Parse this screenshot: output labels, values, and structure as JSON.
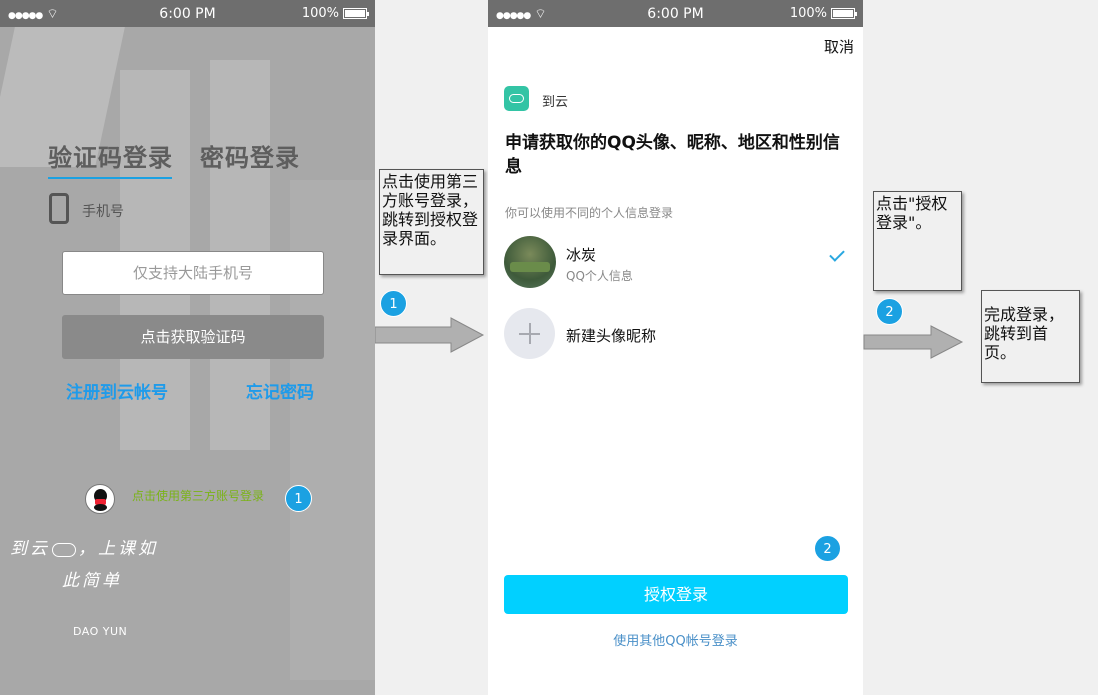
{
  "status": {
    "signal": "●●●●●",
    "time": "6:00 PM",
    "battery": "100%"
  },
  "login": {
    "tab_sms": "验证码登录",
    "tab_password": "密码登录",
    "phone_label": "手机号",
    "phone_placeholder": "仅支持大陆手机号",
    "get_code_button": "点击获取验证码",
    "register_link": "注册到云帐号",
    "forgot_link": "忘记密码",
    "third_party_text": "点击使用第三方账号登录",
    "badge": "1",
    "slogan_line1": "到云",
    "slogan_line1b": "，上课如",
    "slogan_line2": "此简单",
    "brand": "DAO YUN"
  },
  "notes": {
    "note1": "点击使用第三方账号登录，跳转到授权登录界面。",
    "note1_badge": "1",
    "note2": "点击\"授权登录\"。",
    "note2_badge": "2",
    "note3": "完成登录，跳转到首页。"
  },
  "auth": {
    "cancel": "取消",
    "app_name": "到云",
    "title": "申请获取你的QQ头像、昵称、地区和性别信息",
    "hint": "你可以使用不同的个人信息登录",
    "account_name": "冰炭",
    "account_sub": "QQ个人信息",
    "new_profile": "新建头像昵称",
    "badge": "2",
    "authorize_button": "授权登录",
    "other_account_link": "使用其他QQ帐号登录"
  },
  "colors": {
    "accent_blue": "#1ba1e2",
    "auth_button": "#01d0ff",
    "link_blue": "#1f9bea",
    "third_party_green": "#7ab317"
  }
}
